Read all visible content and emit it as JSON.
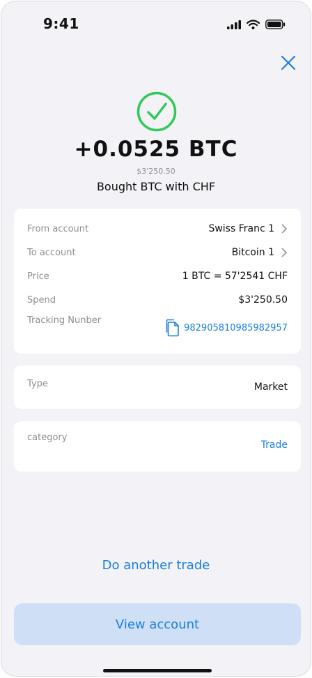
{
  "status_bar": {
    "time": "9:41"
  },
  "header": {
    "amount": "+0.0525 BTC",
    "fiat_amount": "$3'250.50",
    "subtitle": "Bought BTC with CHF"
  },
  "details": {
    "from_account": {
      "label": "From account",
      "value": "Swiss Franc 1"
    },
    "to_account": {
      "label": "To account",
      "value": "Bitcoin 1"
    },
    "price": {
      "label": "Price",
      "value": "1 BTC = 57'2541 CHF"
    },
    "spend": {
      "label": "Spend",
      "value": "$3'250.50"
    },
    "tracking": {
      "label": "Tracking Nunber",
      "value": "982905810985982957"
    }
  },
  "type_card": {
    "label": "Type",
    "value": "Market"
  },
  "category_card": {
    "label": "category",
    "value": "Trade"
  },
  "actions": {
    "another_trade": "Do another trade",
    "view_account": "View account"
  },
  "colors": {
    "accent": "#1a7fe0",
    "success": "#34c759",
    "background": "#f2f2f7",
    "button_bg": "#cfe0f6"
  },
  "icons": {
    "close": "close-icon",
    "success": "checkmark-circle-icon",
    "chevron": "chevron-right-icon",
    "copy": "copy-icon"
  }
}
